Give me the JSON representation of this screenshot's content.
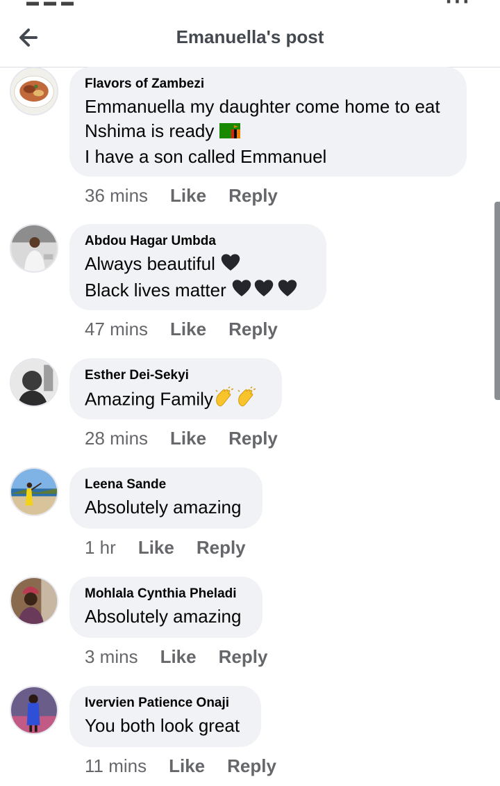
{
  "header": {
    "title": "Emanuella's post"
  },
  "comments": [
    {
      "author": "Flavors of Zambezi",
      "lines": [
        "Emmanuella my daughter come home to eat",
        "Nshima is ready",
        "I have a son called Emmanuel"
      ],
      "time": "36 mins",
      "like": "Like",
      "reply": "Reply"
    },
    {
      "author": "Abdou Hagar Umbda",
      "lines": [
        "Always beautiful",
        "Black lives matter"
      ],
      "time": "47 mins",
      "like": "Like",
      "reply": "Reply"
    },
    {
      "author": "Esther Dei-Sekyi",
      "lines": [
        "Amazing Family"
      ],
      "time": "28 mins",
      "like": "Like",
      "reply": "Reply"
    },
    {
      "author": "Leena Sande",
      "lines": [
        "Absolutely amazing"
      ],
      "time": "1 hr",
      "like": "Like",
      "reply": "Reply"
    },
    {
      "author": "Mohlala Cynthia Pheladi",
      "lines": [
        "Absolutely amazing"
      ],
      "time": "3 mins",
      "like": "Like",
      "reply": "Reply"
    },
    {
      "author": "Ivervien Patience Onaji",
      "lines": [
        "You both look great"
      ],
      "time": "11 mins",
      "like": "Like",
      "reply": "Reply"
    }
  ],
  "icons": {
    "back": "arrow-left-icon",
    "flag": "zambia-flag-emoji",
    "heart": "black-heart-emoji",
    "clap": "clapping-hands-emoji"
  },
  "colors": {
    "bubble": "#f0f2f5",
    "meta_text": "#65676b",
    "title_text": "#444950"
  }
}
